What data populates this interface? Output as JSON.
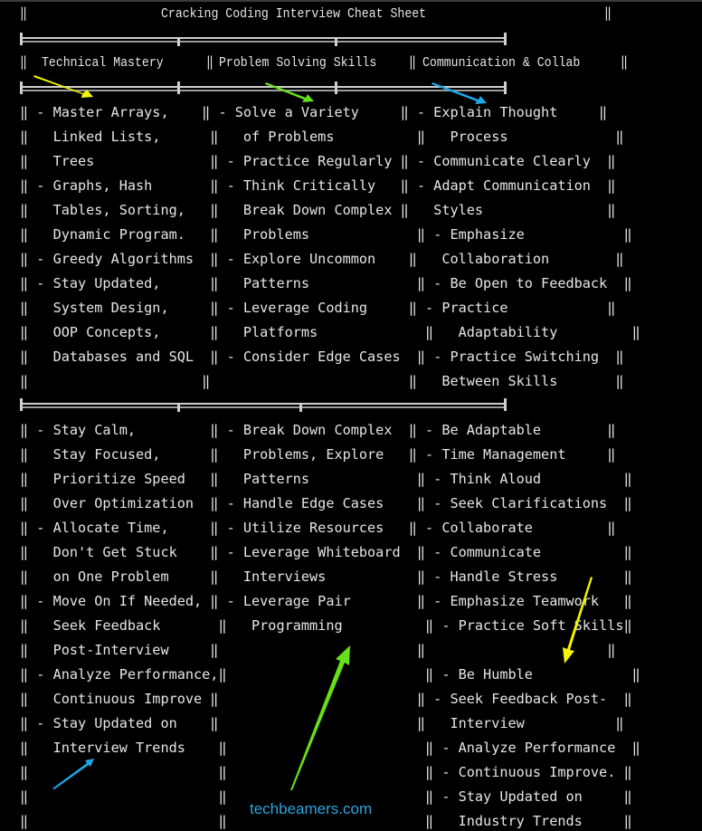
{
  "title": "Cracking Coding Interview Cheat Sheet",
  "headers": [
    "Technical Mastery",
    "Problem Solving Skills",
    "Communication & Collab"
  ],
  "section1_lines": [
    "‖ - Master Arrays,    ‖ - Solve a Variety     ‖ - Explain Thought     ‖",
    "‖   Linked Lists,      ‖   of Problems          ‖   Process             ‖",
    "‖   Trees              ‖ - Practice Regularly ‖ - Communicate Clearly  ‖",
    "‖ - Graphs, Hash       ‖ - Think Critically   ‖ - Adapt Communication  ‖",
    "‖   Tables, Sorting,   ‖   Break Down Complex ‖   Styles               ‖",
    "‖   Dynamic Program.   ‖   Problems             ‖ - Emphasize            ‖",
    "‖ - Greedy Algorithms  ‖ - Explore Uncommon    ‖   Collaboration        ‖",
    "‖ - Stay Updated,      ‖   Patterns             ‖ - Be Open to Feedback  ‖",
    "‖   System Design,     ‖ - Leverage Coding     ‖ - Practice            ‖",
    "‖   OOP Concepts,      ‖   Platforms             ‖   Adaptability         ‖",
    "‖   Databases and SQL  ‖ - Consider Edge Cases  ‖ - Practice Switching  ‖",
    "‖                     ‖                        ‖   Between Skills       ‖"
  ],
  "section2_lines": [
    "‖ - Stay Calm,         ‖ - Break Down Complex  ‖ - Be Adaptable        ‖",
    "‖   Stay Focused,      ‖   Problems, Explore   ‖ - Time Management     ‖",
    "‖   Prioritize Speed   ‖   Patterns             ‖ - Think Aloud          ‖",
    "‖   Over Optimization  ‖ - Handle Edge Cases    ‖ - Seek Clarifications  ‖",
    "‖ - Allocate Time,     ‖ - Utilize Resources   ‖ - Collaborate         ‖",
    "‖   Don't Get Stuck    ‖ - Leverage Whiteboard  ‖ - Communicate          ‖",
    "‖   on One Problem     ‖   Interviews           ‖ - Handle Stress        ‖",
    "‖ - Move On If Needed, ‖ - Leverage Pair        ‖ - Emphasize Teamwork   ‖",
    "‖   Seek Feedback       ‖   Programming          ‖ - Practice Soft Skills‖",
    "‖   Post-Interview     ‖                        ‖                      ‖",
    "‖ - Analyze Performance,‖                        ‖ - Be Humble            ‖",
    "‖   Continuous Improve ‖                        ‖ - Seek Feedback Post-  ‖",
    "‖ - Stay Updated on    ‖                        ‖   Interview           ‖",
    "‖   Interview Trends    ‖                        ‖ - Analyze Performance  ‖",
    "‖                       ‖                        ‖ - Continuous Improve. ‖",
    "‖                       ‖                        ‖ - Stay Updated on     ‖",
    "‖                       ‖                        ‖   Industry Trends     ‖"
  ],
  "watermark": "techbeamers.com",
  "colors": {
    "background": "#000000",
    "text": "#e6e6e6",
    "watermark": "#2ea3dc",
    "arrow_yellow": "#f5f500",
    "arrow_green": "#66e01a",
    "arrow_blue": "#1ea8e8"
  }
}
